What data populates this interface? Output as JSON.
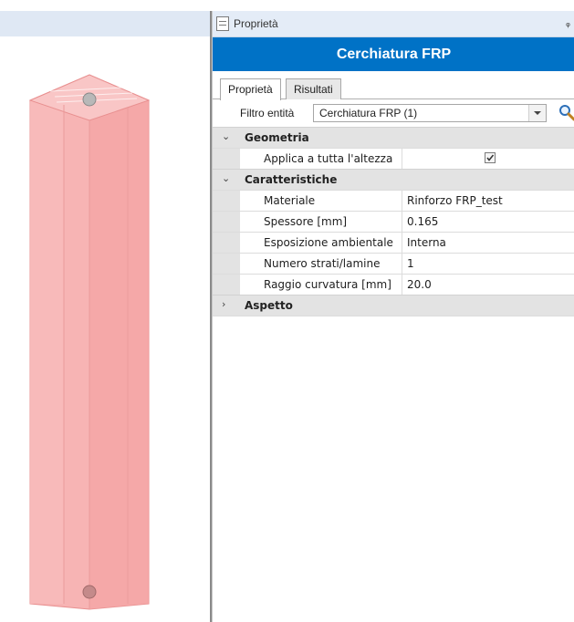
{
  "panel": {
    "title": "Proprietà",
    "header": "Cerchiatura FRP",
    "tabs": [
      {
        "label": "Proprietà",
        "active": true
      },
      {
        "label": "Risultati",
        "active": false
      }
    ],
    "filter": {
      "label": "Filtro entità",
      "value": "Cerchiatura FRP (1)"
    },
    "categories": [
      {
        "label": "Geometria",
        "expanded": true,
        "properties": [
          {
            "name": "Applica a tutta l'altezza",
            "value": "",
            "checked": true
          }
        ]
      },
      {
        "label": "Caratteristiche",
        "expanded": true,
        "properties": [
          {
            "name": "Materiale",
            "value": "Rinforzo FRP_test"
          },
          {
            "name": "Spessore  [mm]",
            "value": "0.165"
          },
          {
            "name": "Esposizione ambientale",
            "value": "Interna"
          },
          {
            "name": "Numero strati/lamine",
            "value": "1"
          },
          {
            "name": "Raggio curvatura  [mm]",
            "value": "20.0"
          }
        ]
      },
      {
        "label": "Aspetto",
        "expanded": false,
        "properties": []
      }
    ]
  },
  "colors": {
    "accent": "#0072c6",
    "column_fill": "#f4a6a6",
    "category_bg": "#e3e3e3"
  },
  "icons": {
    "panel": "properties-icon",
    "filter_search": "magnifier-icon",
    "expand": "chevron-down-icon",
    "collapse": "chevron-right-icon"
  }
}
